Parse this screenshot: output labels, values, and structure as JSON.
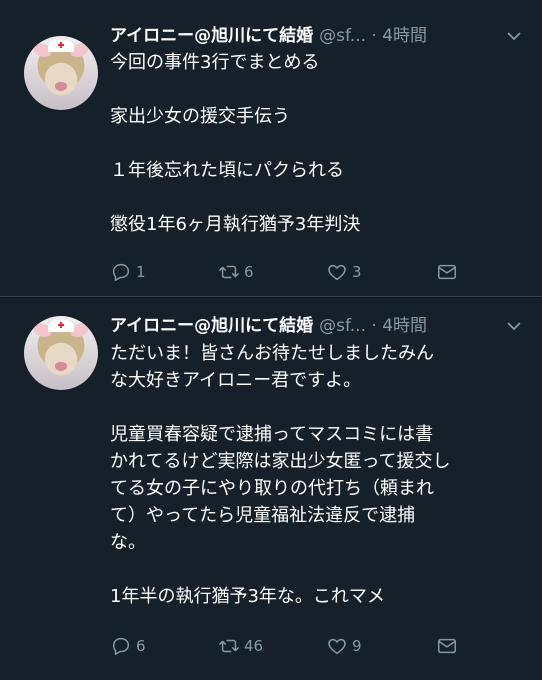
{
  "colors": {
    "background": "#15202b",
    "text": "#ffffff",
    "muted": "#8899a6"
  },
  "tweets": [
    {
      "name": "アイロニー@旭川にて結婚",
      "handle": "@sf...",
      "time": "· 4時間",
      "lines": [
        "今回の事件3行でまとめる",
        "",
        "家出少女の援交手伝う",
        "",
        "１年後忘れた頃にパクられる",
        "",
        "懲役1年6ヶ月執行猶予3年判決"
      ],
      "replies": "1",
      "retweets": "6",
      "likes": "3"
    },
    {
      "name": "アイロニー@旭川にて結婚",
      "handle": "@sf...",
      "time": "· 4時間",
      "lines": [
        "ただいま！皆さんお待たせしましたみん",
        "な大好きアイロニー君ですよ。",
        "",
        "児童買春容疑で逮捕ってマスコミには書",
        "かれてるけど実際は家出少女匿って援交し",
        "てる女の子にやり取りの代打ち（頼まれ",
        "て）やってたら児童福祉法違反で逮捕",
        "な。",
        "",
        "1年半の執行猶予3年な。これマメ"
      ],
      "replies": "6",
      "retweets": "46",
      "likes": "9"
    }
  ]
}
